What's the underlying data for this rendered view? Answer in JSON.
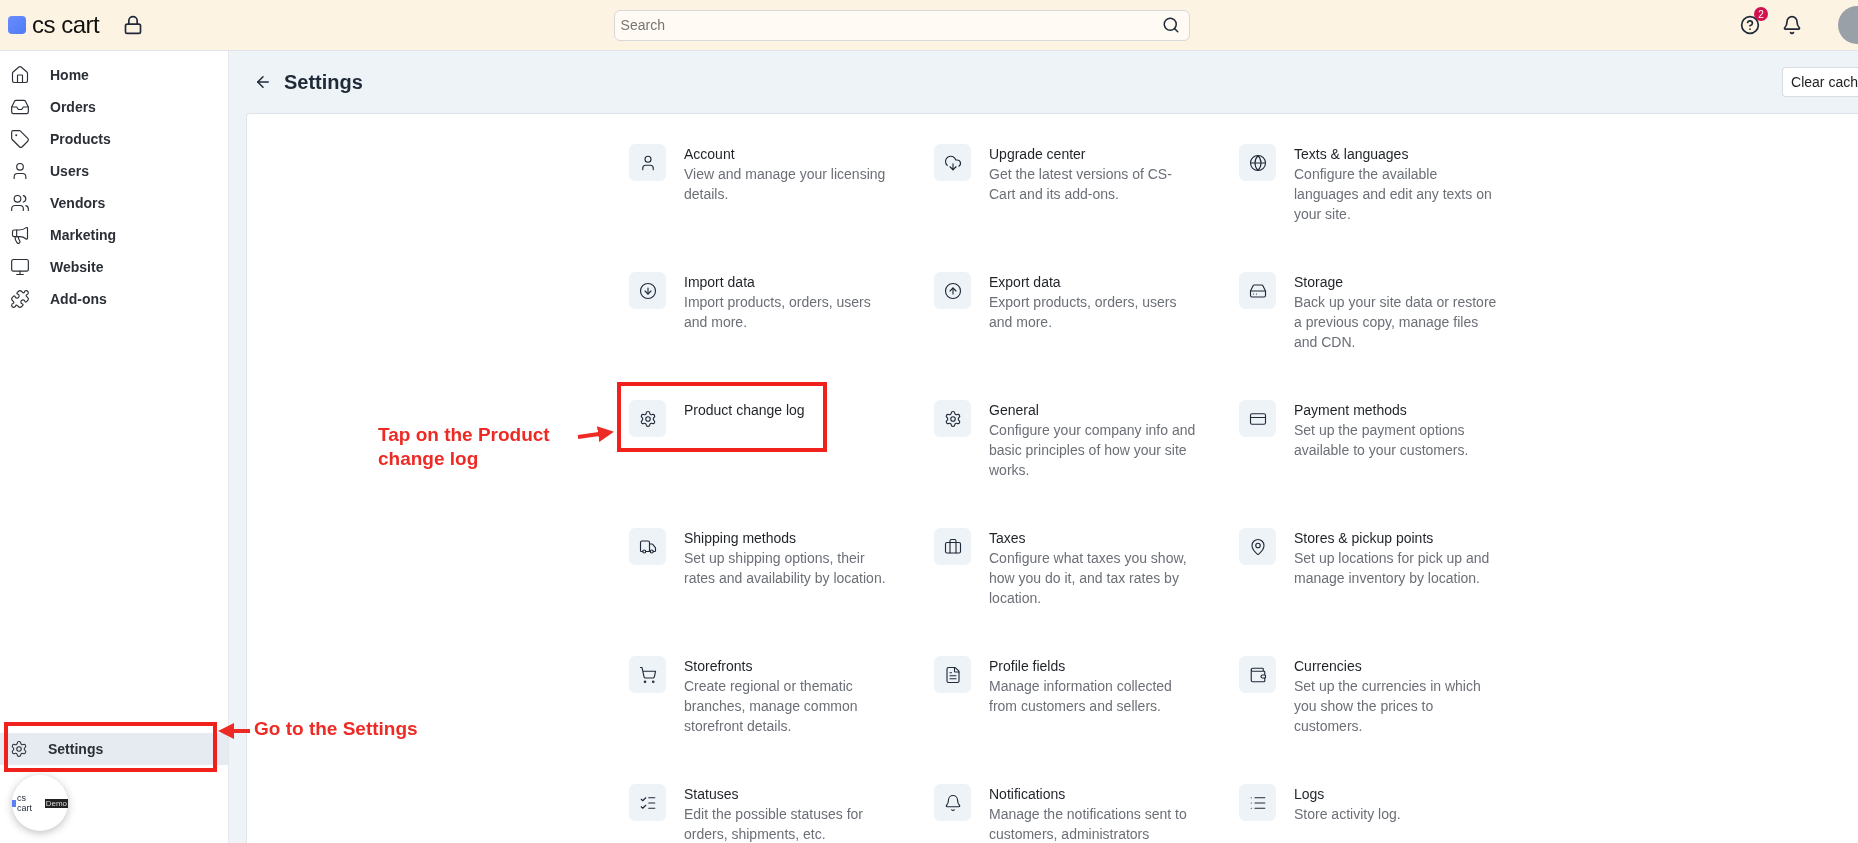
{
  "header": {
    "logo": "cs cart",
    "search": {
      "placeholder": "Search"
    },
    "help_badge": "2"
  },
  "sidebar": {
    "items": [
      {
        "label": "Home",
        "selected": false
      },
      {
        "label": "Orders",
        "selected": false
      },
      {
        "label": "Products",
        "selected": false
      },
      {
        "label": "Users",
        "selected": false
      },
      {
        "label": "Vendors",
        "selected": false
      },
      {
        "label": "Marketing",
        "selected": false
      },
      {
        "label": "Website",
        "selected": false
      },
      {
        "label": "Add-ons",
        "selected": false
      }
    ],
    "bottom_item": {
      "label": "Settings",
      "selected": true
    },
    "footer_logo": {
      "text": "cs cart",
      "badge": "Demo"
    }
  },
  "page": {
    "title": "Settings",
    "button": "Clear cach"
  },
  "settings": [
    {
      "title": "Account",
      "description": "View and manage your licensing details."
    },
    {
      "title": "Upgrade center",
      "description": "Get the latest versions of CS-Cart and its add-ons."
    },
    {
      "title": "Texts & languages",
      "description": "Configure the available languages and edit any texts on your site."
    },
    {
      "title": "Import data",
      "description": "Import products, orders, users and more."
    },
    {
      "title": "Export data",
      "description": "Export products, orders, users and more."
    },
    {
      "title": "Storage",
      "description": "Back up your site data or restore a previous copy, manage files and CDN."
    },
    {
      "title": "Product change log"
    },
    {
      "title": "General",
      "description": "Configure your company info and basic principles of how your site works."
    },
    {
      "title": "Payment methods",
      "description": "Set up the payment options available to your customers."
    },
    {
      "title": "Shipping methods",
      "description": "Set up shipping options, their rates and availability by location."
    },
    {
      "title": "Taxes",
      "description": "Configure what taxes you show, how you do it, and tax rates by location."
    },
    {
      "title": "Stores & pickup points",
      "description": "Set up locations for pick up and manage inventory by location."
    },
    {
      "title": "Storefronts",
      "description": "Create regional or thematic branches, manage common storefront details."
    },
    {
      "title": "Profile fields",
      "description": "Manage information collected from customers and sellers."
    },
    {
      "title": "Currencies",
      "description": "Set up the currencies in which you show the prices to customers."
    },
    {
      "title": "Statuses",
      "description": "Edit the possible statuses for orders, shipments, etc."
    },
    {
      "title": "Notifications",
      "description": "Manage the notifications sent to customers, administrators"
    },
    {
      "title": "Logs",
      "description": "Store activity log."
    }
  ],
  "annotations": [
    {
      "text": "Tap on the Product change log",
      "kind": "card"
    },
    {
      "text": "Go to the Settings",
      "kind": "sidebar"
    }
  ]
}
